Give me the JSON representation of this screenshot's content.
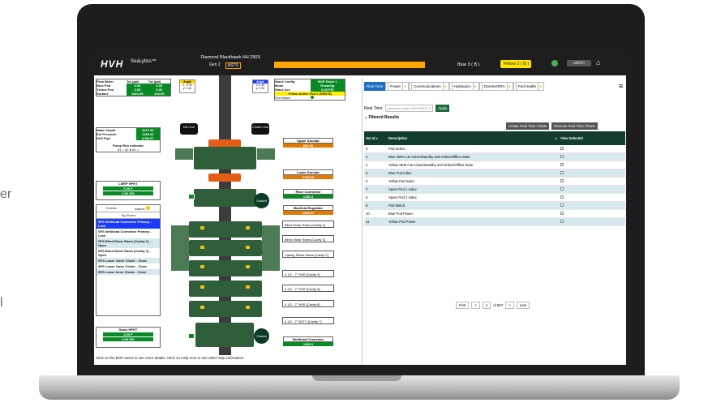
{
  "page": {
    "side_text_top": "er",
    "side_text_bottom": "l"
  },
  "topbar": {
    "logo": "HVH",
    "brand": "SeaLytics™",
    "rig": "Diamond Blackhawk HH 2503",
    "gen": "Gen 2",
    "asts": "ASTS",
    "blue": "Blue 3 ( B )",
    "yellow": "Yellow 3 ( B )",
    "user": "admin",
    "accent_orange": "#ffa500"
  },
  "left": {
    "flow_header": [
      "Flow Meter",
      "Tot (gal)",
      "Tot (gal)"
    ],
    "flow_rows": [
      [
        "Blue Pod",
        "0.00",
        "0.00"
      ],
      [
        "Yellow Pod",
        "0.00",
        "0.00"
      ],
      [
        "Surface",
        "1821.80",
        "242.00"
      ]
    ],
    "angle_left": {
      "title": "Angle",
      "x": "x: -0.30",
      "y": "y: 3.40"
    },
    "angle_right": {
      "title": "Angle",
      "x": "x: 0.40",
      "y": "y: 0.30"
    },
    "water_rows": [
      [
        "Water Depth",
        "2027.93"
      ],
      [
        "Ext Pressure",
        "1380.00"
      ],
      [
        "Drill Pipe",
        "6-5/8 57"
      ]
    ],
    "pump_title": "Pump Run Indicator",
    "pump_states": "#1 ○  #2 ●  #3 ○",
    "lmrp_title": "LMRP HPHT",
    "lmrp_temp": "0.00 F",
    "lmrp_psi": "0.00 PSI",
    "events": "Events",
    "alarms": "Alarms",
    "top_event": "Top Event",
    "events_list": [
      "SFS Wellhead Connector Primary - Lock",
      "SFS Wellhead Connector Primary - Lock",
      "SFS Blind Shear Rams [Cavity 1] - Open",
      "SFS Blind Shear Rams [Cavity 1] - Open",
      "SFS Lower Outer Choke - Close",
      "SFS Lower Outer Choke - Close",
      "SFS Lower Inner Choke - Close"
    ],
    "stack_title": "Stack HPHT",
    "stack_temp": "0.00 F",
    "stack_psi": "0.00 PSI",
    "footer": "Click on the BOP asset to see more details. Click on Help Icon to see other help information"
  },
  "config": {
    "rows": [
      [
        "Stack Config",
        "BOP Stack 1"
      ],
      [
        "Mode",
        "Roaming"
      ],
      [
        "Stack Acc",
        "0.00 PSI"
      ]
    ],
    "active_pod": "Yellow Active Pod 2 (SEM B)",
    "pod_match": "Pod Match"
  },
  "stack": {
    "kill": "Kill Line",
    "choke": "Choke Line",
    "gasket1": "Gasket",
    "gasket2": "Gasket"
  },
  "labels": [
    {
      "name": "Upper Annular",
      "value": "820.00",
      "kind": "orange"
    },
    {
      "name": "Lower Annular",
      "value": "5780.00",
      "kind": "orange"
    },
    {
      "name": "Riser Connector",
      "value": "1280.4",
      "kind": "green"
    },
    {
      "name": "Manifold Regulator",
      "value": "1365.67",
      "kind": "orange"
    }
  ],
  "rams": [
    "Blind Shear Rams [Cavity 1]",
    "Blind Shear Rams [Cavity 3]",
    "Casing Shear Rams [Cavity 2]",
    "4 1/2 - 7\" HVR [Cavity 4]",
    "4 1/2 - 7\" HVR [Cavity 5]",
    "4 1/2 - 7\" HVR [Cavity 6]",
    "4 1/2 - 7\" BSTV [Cavity 7]"
  ],
  "wellhead": {
    "name": "Wellhead Connector",
    "value": "1390.0"
  },
  "right": {
    "tabs": [
      "Real Time",
      "Power",
      "Communications",
      "Hydraulics",
      "Diverter/ERA",
      "Pod Health"
    ],
    "rt_label": "Real Time",
    "rt_select": "pressure1-demo 01/18/2022 2",
    "apply": "Apply",
    "filtered": "Filtered Results",
    "btn1": "Create Real Time Charts",
    "btn2": "Remove Real Time Charts",
    "col_var": "Var Id",
    "col_desc": "Description",
    "col_view": "View Selected",
    "rows": [
      [
        "0",
        "Pod Select"
      ],
      [
        "1",
        "Blue SEM A,B Active/Standby and Online/Offline State"
      ],
      [
        "2",
        "Yellow SEM A,B Active/Standby and Online/Offline State"
      ],
      [
        "5",
        "Blue Pod Index"
      ],
      [
        "6",
        "Yellow Pod Index"
      ],
      [
        "7",
        "Spare Pod 1 Index"
      ],
      [
        "8",
        "Spare Pod 2 Index"
      ],
      [
        "9",
        "Pod Match"
      ],
      [
        "10",
        "Blue Pod Power"
      ],
      [
        "11",
        "Yellow Pod Power"
      ]
    ],
    "pager": {
      "first": "First",
      "prev": "<",
      "page": "1",
      "of": "of 557",
      "next": ">",
      "last": "Last"
    }
  }
}
